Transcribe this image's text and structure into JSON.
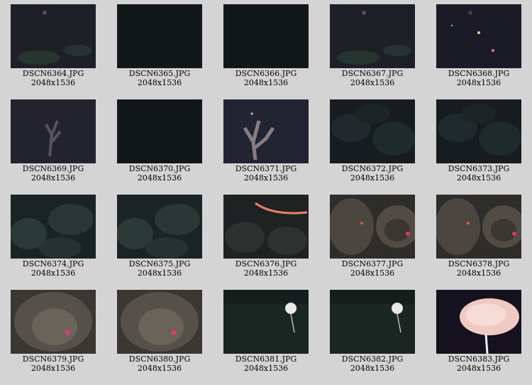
{
  "gallery": {
    "items": [
      {
        "name": "DSCN6364.JPG",
        "dims": "2048x1536",
        "scene": "dark-green"
      },
      {
        "name": "DSCN6365.JPG",
        "dims": "2048x1536",
        "scene": "dark"
      },
      {
        "name": "DSCN6366.JPG",
        "dims": "2048x1536",
        "scene": "dark"
      },
      {
        "name": "DSCN6367.JPG",
        "dims": "2048x1536",
        "scene": "dark-green"
      },
      {
        "name": "DSCN6368.JPG",
        "dims": "2048x1536",
        "scene": "dark-specks"
      },
      {
        "name": "DSCN6369.JPG",
        "dims": "2048x1536",
        "scene": "coral-faint"
      },
      {
        "name": "DSCN6370.JPG",
        "dims": "2048x1536",
        "scene": "dark"
      },
      {
        "name": "DSCN6371.JPG",
        "dims": "2048x1536",
        "scene": "coral"
      },
      {
        "name": "DSCN6372.JPG",
        "dims": "2048x1536",
        "scene": "rock-dark"
      },
      {
        "name": "DSCN6373.JPG",
        "dims": "2048x1536",
        "scene": "rock-dark"
      },
      {
        "name": "DSCN6374.JPG",
        "dims": "2048x1536",
        "scene": "rock-green"
      },
      {
        "name": "DSCN6375.JPG",
        "dims": "2048x1536",
        "scene": "rock-green"
      },
      {
        "name": "DSCN6376.JPG",
        "dims": "2048x1536",
        "scene": "rock-whip"
      },
      {
        "name": "DSCN6377.JPG",
        "dims": "2048x1536",
        "scene": "pillow-rock"
      },
      {
        "name": "DSCN6378.JPG",
        "dims": "2048x1536",
        "scene": "pillow-rock"
      },
      {
        "name": "DSCN6379.JPG",
        "dims": "2048x1536",
        "scene": "pillow-close"
      },
      {
        "name": "DSCN6380.JPG",
        "dims": "2048x1536",
        "scene": "pillow-close"
      },
      {
        "name": "DSCN6381.JPG",
        "dims": "2048x1536",
        "scene": "sponge-field"
      },
      {
        "name": "DSCN6382.JPG",
        "dims": "2048x1536",
        "scene": "sponge-field"
      },
      {
        "name": "DSCN6383.JPG",
        "dims": "2048x1536",
        "scene": "sponge-close"
      }
    ]
  }
}
